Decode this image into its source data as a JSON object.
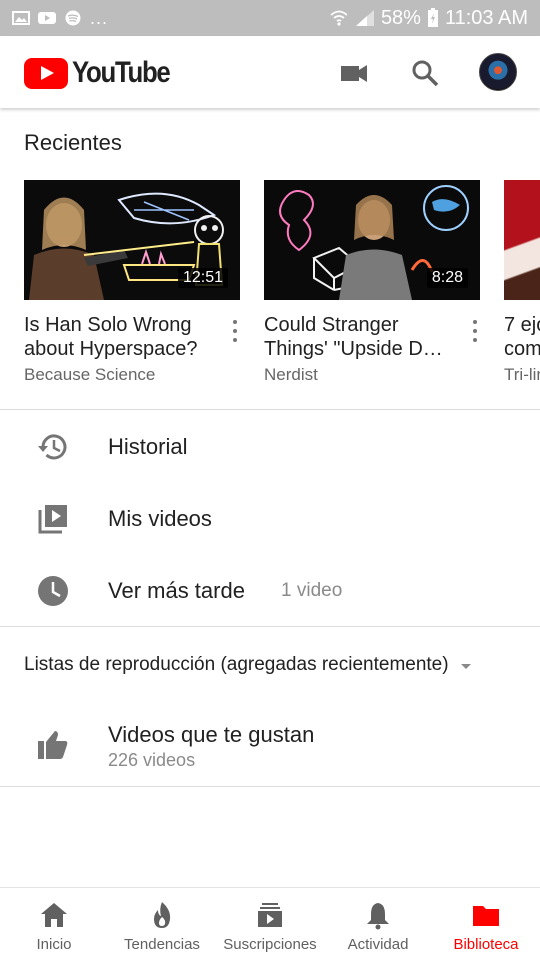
{
  "status_bar": {
    "battery": "58%",
    "time": "11:03 AM",
    "overflow": "..."
  },
  "app": {
    "logo_text": "YouTube",
    "brand_color": "#ff0000",
    "actions": [
      "camera-icon",
      "search-icon",
      "account-avatar"
    ]
  },
  "recents": {
    "title": "Recientes",
    "videos": [
      {
        "title": "Is Han Solo Wrong about Hyperspace?",
        "channel": "Because Science",
        "duration": "12:51"
      },
      {
        "title": "Could Stranger Things' \"Upside D…",
        "channel": "Nerdist",
        "duration": "8:28"
      },
      {
        "title": "7 ejo\ncom",
        "channel": "Tri-lin",
        "duration": ""
      }
    ]
  },
  "menu": {
    "history": "Historial",
    "my_videos": "Mis videos",
    "watch_later": "Ver más tarde",
    "watch_later_count": "1 video"
  },
  "playlists": {
    "header": "Listas de reproducción (agregadas recientemente)",
    "liked_title": "Videos que te gustan",
    "liked_count": "226 videos"
  },
  "bottom_nav": [
    {
      "label": "Inicio",
      "icon": "home-icon",
      "active": false
    },
    {
      "label": "Tendencias",
      "icon": "flame-icon",
      "active": false
    },
    {
      "label": "Suscripciones",
      "icon": "subscriptions-icon",
      "active": false
    },
    {
      "label": "Actividad",
      "icon": "bell-icon",
      "active": false
    },
    {
      "label": "Biblioteca",
      "icon": "folder-icon",
      "active": true
    }
  ]
}
